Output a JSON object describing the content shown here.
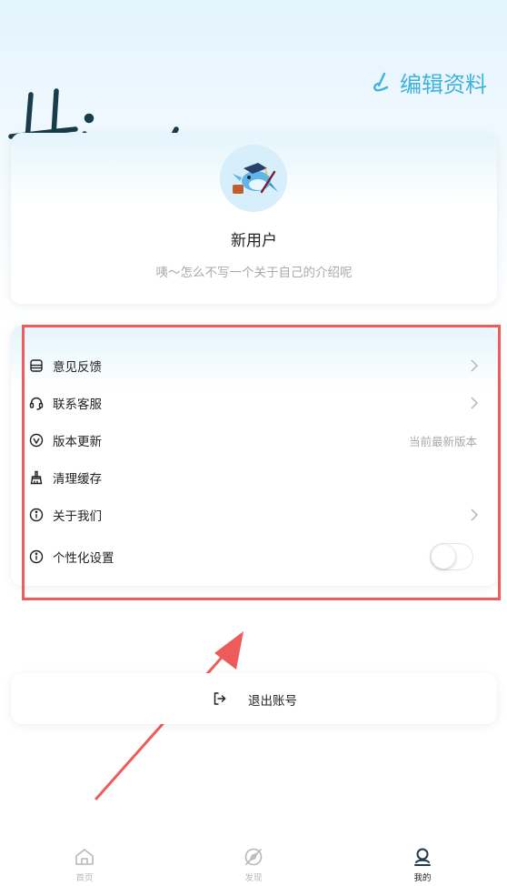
{
  "header": {
    "edit_label": "编辑资料",
    "greeting_handwriting": "Hi~"
  },
  "profile": {
    "name": "新用户",
    "bio": "咦～怎么不写一个关于自己的介绍呢"
  },
  "menu": {
    "items": [
      {
        "label": "意见反馈",
        "icon": "feedback-icon"
      },
      {
        "label": "联系客服",
        "icon": "headset-icon"
      },
      {
        "label": "版本更新",
        "icon": "version-icon",
        "value": "当前最新版本"
      },
      {
        "label": "清理缓存",
        "icon": "brush-icon"
      },
      {
        "label": "关于我们",
        "icon": "info-icon"
      },
      {
        "label": "个性化设置",
        "icon": "info-icon",
        "toggle_on": false
      }
    ]
  },
  "logout": {
    "label": "退出账号"
  },
  "tabs": [
    {
      "label": "首页",
      "icon": "home-icon",
      "active": false
    },
    {
      "label": "发现",
      "icon": "discover-icon",
      "active": false
    },
    {
      "label": "我的",
      "icon": "user-icon",
      "active": true
    }
  ],
  "colors": {
    "accent": "#3fb2e0",
    "annotation": "#ee5b5b",
    "handwriting": "#173c4a"
  }
}
